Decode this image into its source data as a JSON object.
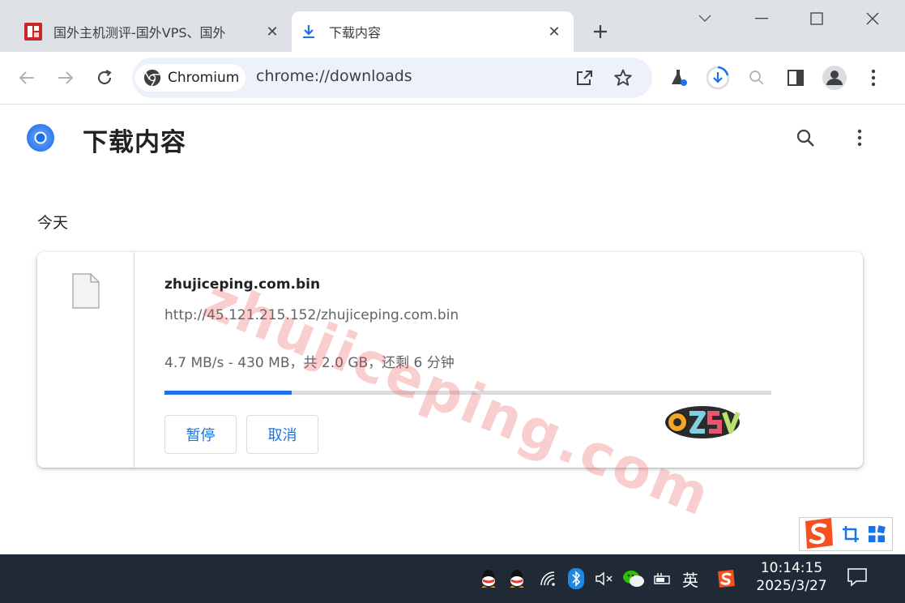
{
  "tabs": [
    {
      "title": "国外主机测评-国外VPS、国外",
      "favicon": "site-favicon",
      "close": "✕"
    },
    {
      "title": "下载内容",
      "favicon": "download-icon",
      "close": "✕"
    }
  ],
  "new_tab_glyph": "+",
  "omnibox": {
    "chip_label": "Chromium",
    "url": "chrome://downloads"
  },
  "page": {
    "heading": "下载内容",
    "section": "今天"
  },
  "download": {
    "filename": "zhujiceping.com.bin",
    "url": "http://45.121.215.152/zhujiceping.com.bin",
    "status": "4.7 MB/s - 430 MB，共 2.0 GB，还剩 6 分钟",
    "progress": 0.21,
    "pause_label": "暂停",
    "cancel_label": "取消"
  },
  "watermark": "zhujiceping.com",
  "taskbar": {
    "ime_label": "英",
    "time": "10:14:15",
    "date": "2025/3/27"
  },
  "colors": {
    "accent": "#1a73e8",
    "tabstrip": "#dee1e6",
    "taskbar": "#1f2a36",
    "omnibox": "#edf2fa"
  }
}
